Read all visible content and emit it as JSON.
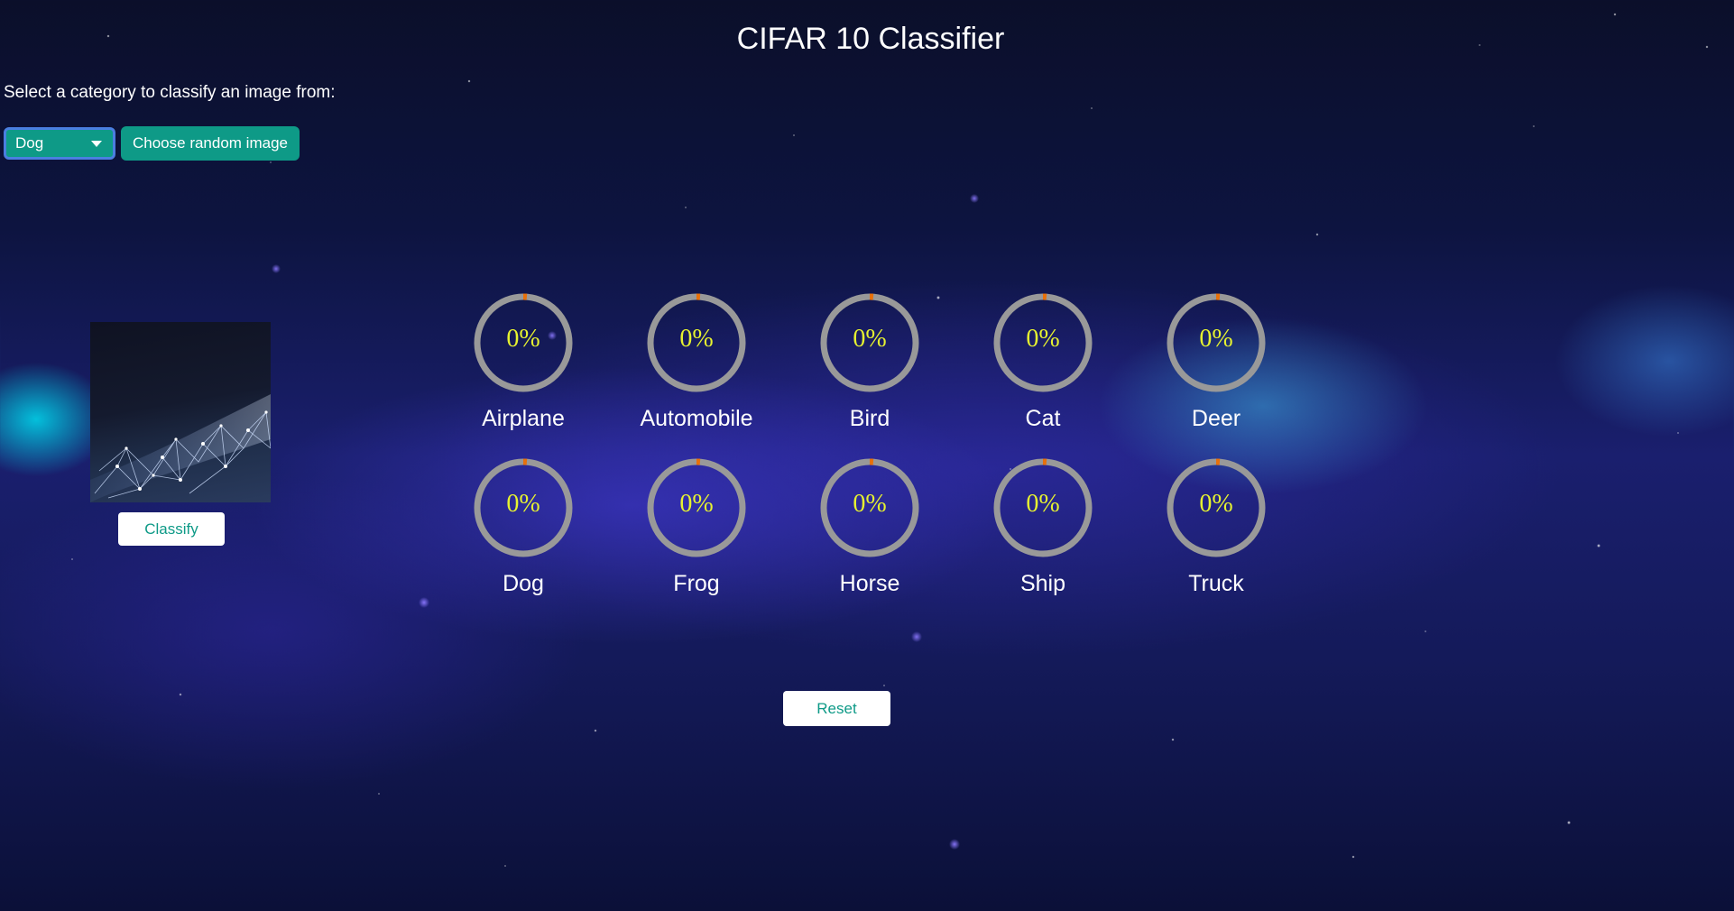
{
  "page": {
    "title": "CIFAR 10 Classifier",
    "prompt": "Select a category to classify an image from:"
  },
  "controls": {
    "category_selected": "Dog",
    "random_button_label": "Choose random image",
    "classify_label": "Classify",
    "reset_label": "Reset"
  },
  "colors": {
    "accent": "#0e9a87",
    "gauge_track": "#999999",
    "gauge_progress": "#e8700a",
    "gauge_value_text": "#e6f230"
  },
  "gauges": [
    {
      "label": "Airplane",
      "value_text": "0%",
      "value": 0
    },
    {
      "label": "Automobile",
      "value_text": "0%",
      "value": 0
    },
    {
      "label": "Bird",
      "value_text": "0%",
      "value": 0
    },
    {
      "label": "Cat",
      "value_text": "0%",
      "value": 0
    },
    {
      "label": "Deer",
      "value_text": "0%",
      "value": 0
    },
    {
      "label": "Dog",
      "value_text": "0%",
      "value": 0
    },
    {
      "label": "Frog",
      "value_text": "0%",
      "value": 0
    },
    {
      "label": "Horse",
      "value_text": "0%",
      "value": 0
    },
    {
      "label": "Ship",
      "value_text": "0%",
      "value": 0
    },
    {
      "label": "Truck",
      "value_text": "0%",
      "value": 0
    }
  ]
}
